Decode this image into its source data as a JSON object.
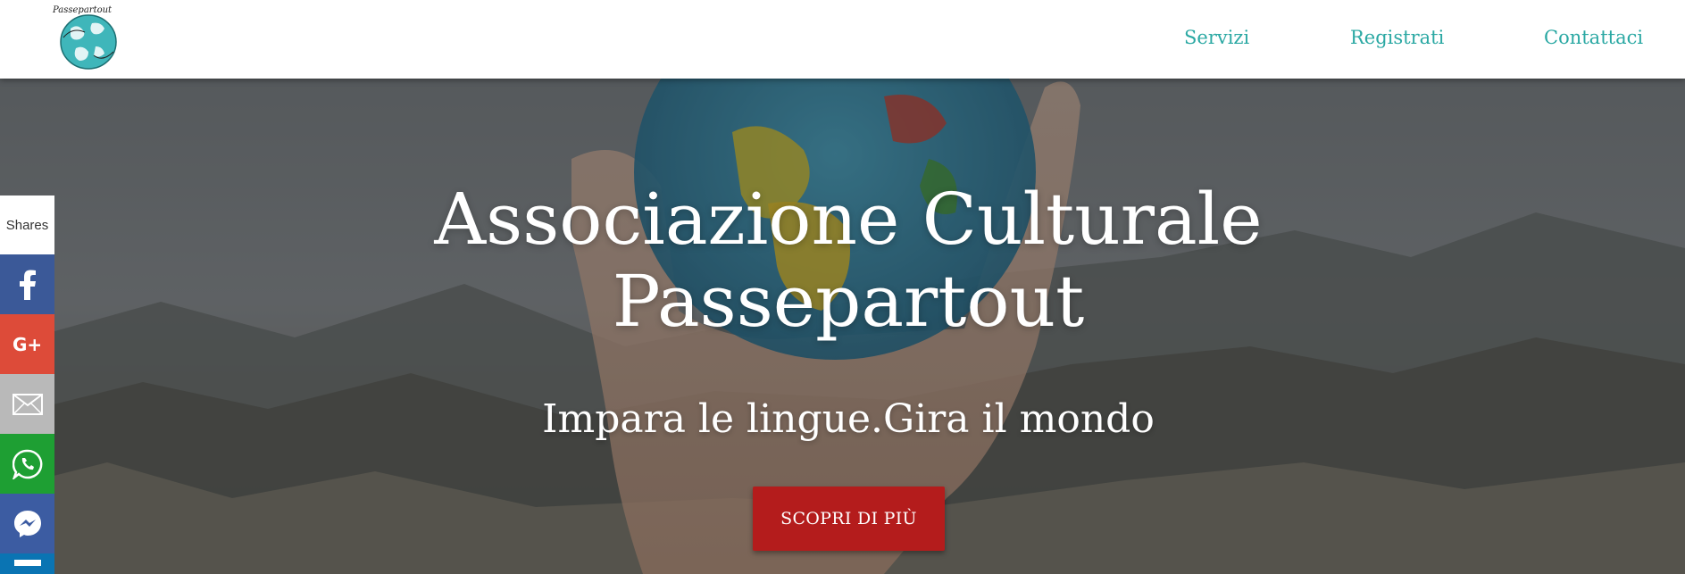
{
  "header": {
    "logo_text": "Passepartout",
    "nav": {
      "servizi": "Servizi",
      "registrati": "Registrati",
      "contattaci": "Contattaci"
    }
  },
  "hero": {
    "title_line1": "Associazione Culturale",
    "title_line2": "Passepartout",
    "subtitle": "Impara le lingue.Gira il mondo",
    "cta_label": "SCOPRI DI PIÙ",
    "background": "hand holding a globe over a mountain landscape"
  },
  "share_bar": {
    "label": "Shares",
    "buttons": [
      {
        "name": "facebook",
        "icon": "facebook-icon",
        "color": "#3b5998"
      },
      {
        "name": "google-plus",
        "icon": "google-plus-icon",
        "color": "#dd4b39"
      },
      {
        "name": "email",
        "icon": "email-icon",
        "color": "#b9b9b9"
      },
      {
        "name": "whatsapp",
        "icon": "whatsapp-icon",
        "color": "#1e9f33"
      },
      {
        "name": "messenger",
        "icon": "messenger-icon",
        "color": "#3c5ca2"
      },
      {
        "name": "linkedin",
        "icon": "linkedin-icon",
        "color": "#0a74b3"
      }
    ]
  },
  "colors": {
    "accent": "#2aa8a3",
    "cta": "#b41c1c",
    "header_bg": "#ffffff"
  }
}
